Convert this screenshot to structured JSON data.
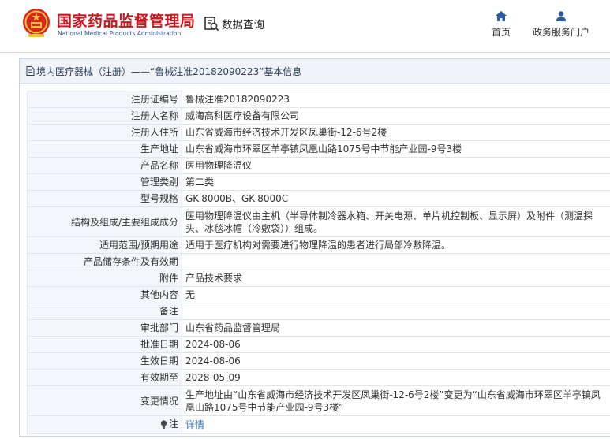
{
  "header": {
    "brand_cn": "国家药品监督管理局",
    "brand_en": "National Medical Products Administration",
    "search_label": "数据查询",
    "nav": {
      "home_label": "首页",
      "gov_portal_label": "政务服务门户"
    }
  },
  "colors": {
    "brand_red": "#c8171e",
    "brand_blue": "#2a4f8f",
    "nav_blue": "#2a5aa4",
    "label_bg": "#f3f6fa",
    "link": "#2c6fb9"
  },
  "panel": {
    "title": "境内医疗器械（注册）——“鲁械注准20182090223”基本信息"
  },
  "rows": [
    {
      "label": "注册证编号",
      "value": "鲁械注准20182090223"
    },
    {
      "label": "注册人名称",
      "value": "威海高科医疗设备有限公司"
    },
    {
      "label": "注册人住所",
      "value": "山东省威海市经济技术开发区凤巢街-12-6号2楼"
    },
    {
      "label": "生产地址",
      "value": "山东省威海市环翠区羊亭镇凤凰山路1075号中节能产业园-9号3楼"
    },
    {
      "label": "产品名称",
      "value": "医用物理降温仪"
    },
    {
      "label": "管理类别",
      "value": "第二类"
    },
    {
      "label": "型号规格",
      "value": "GK-8000B、GK-8000C"
    },
    {
      "label": "结构及组成/主要组成成分",
      "value": "医用物理降温仪由主机（半导体制冷器水箱、开关电源、单片机控制板、显示屏）及附件（测温探头、冰毯冰帽（冷敷袋））组成。"
    },
    {
      "label": "适用范围/预期用途",
      "value": "适用于医疗机构对需要进行物理降温的患者进行局部冷敷降温。"
    },
    {
      "label": "产品储存条件及有效期",
      "value": ""
    },
    {
      "label": "附件",
      "value": "产品技术要求"
    },
    {
      "label": "其他内容",
      "value": "无"
    },
    {
      "label": "备注",
      "value": ""
    },
    {
      "label": "审批部门",
      "value": "山东省药品监督管理局"
    },
    {
      "label": "批准日期",
      "value": "2024-08-06"
    },
    {
      "label": "生效日期",
      "value": "2024-08-06"
    },
    {
      "label": "有效期至",
      "value": "2028-05-09"
    },
    {
      "label": "变更情况",
      "value": "生产地址由“山东省威海市经济技术开发区凤巢街-12-6号2楼”变更为“山东省威海市环翠区羊亭镇凤凰山路1075号中节能产业园-9号3楼”"
    }
  ],
  "notice_row": {
    "label": "注",
    "icon": "bulb-icon",
    "link_label": "详情"
  }
}
